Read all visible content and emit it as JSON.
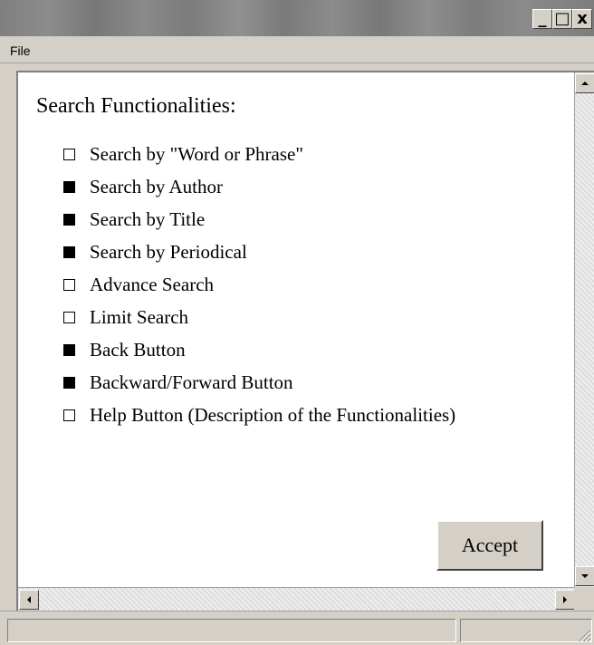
{
  "window": {
    "controls": {
      "minimize": "_",
      "maximize": "□",
      "close": "x"
    }
  },
  "menu": {
    "items": [
      "File"
    ]
  },
  "panel": {
    "heading": "Search Functionalities:",
    "items": [
      {
        "label": "Search by \"Word or Phrase\"",
        "filled": false
      },
      {
        "label": "Search by Author",
        "filled": true
      },
      {
        "label": "Search by Title",
        "filled": true
      },
      {
        "label": "Search by Periodical",
        "filled": true
      },
      {
        "label": "Advance Search",
        "filled": false
      },
      {
        "label": "Limit Search",
        "filled": false
      },
      {
        "label": "Back Button",
        "filled": true
      },
      {
        "label": "Backward/Forward Button",
        "filled": true
      },
      {
        "label": "Help Button (Description of the Functionalities)",
        "filled": false
      }
    ],
    "accept_label": "Accept"
  },
  "icons": {
    "minimize": "minimize-icon",
    "maximize": "maximize-icon",
    "close": "close-icon",
    "scroll_up": "scroll-up-arrow-icon",
    "scroll_down": "scroll-down-arrow-icon",
    "scroll_left": "scroll-left-arrow-icon",
    "scroll_right": "scroll-right-arrow-icon",
    "resize_grip": "resize-grip-icon"
  },
  "colors": {
    "window_bg": "#d4d0c8",
    "content_bg": "#ffffff",
    "title_bar": "#808080"
  }
}
